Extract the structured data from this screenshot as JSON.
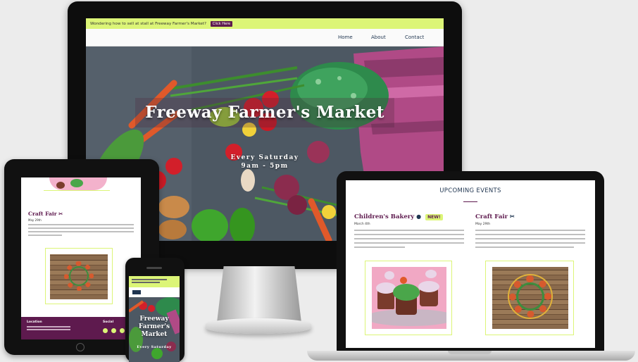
{
  "site": {
    "announcement": "Wondering how to sell at stall at Freeway Farmer's Market?",
    "announcement_button": "Click Here",
    "nav": [
      "Home",
      "About",
      "Contact"
    ],
    "hero_title": "Freeway Farmer's Market",
    "hero_line1": "Every Saturday",
    "hero_line2": "9am - 5pm"
  },
  "events": {
    "heading": "UPCOMING EVENTS",
    "new_badge": "NEW!",
    "items": [
      {
        "title": "Children's Bakery",
        "date": "March 4th"
      },
      {
        "title": "Craft Fair",
        "date": "May 29th"
      }
    ]
  },
  "tablet": {
    "event_title": "Craft Fair",
    "event_date": "May 29th",
    "footer_location": "Location",
    "footer_social": "Social"
  },
  "colors": {
    "accent_lime": "#dcf577",
    "brand_plum": "#5e1a4e",
    "nav_navy": "#1f3550"
  },
  "icons": [
    "cupcake-icon",
    "scissors-icon"
  ]
}
